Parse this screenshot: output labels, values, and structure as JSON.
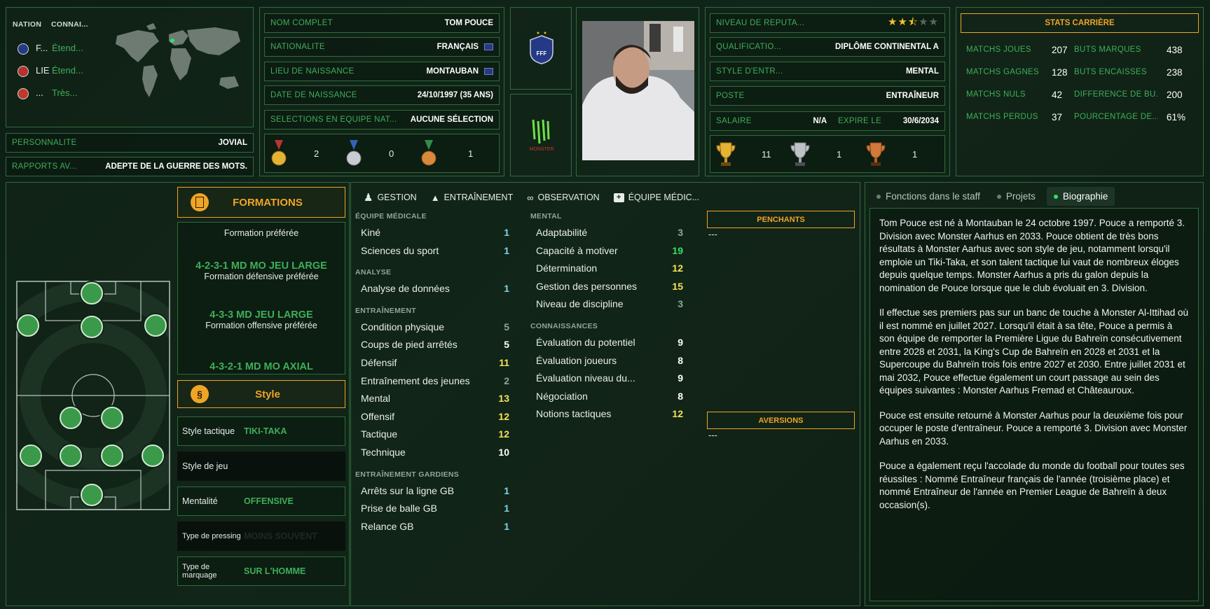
{
  "left": {
    "nation_header": "NATION",
    "connais_header": "CONNAI...",
    "nations": [
      {
        "abbr": "F...",
        "level": "Étend..."
      },
      {
        "abbr": "LIE",
        "level": "Étend..."
      },
      {
        "abbr": "...",
        "level": "Très..."
      }
    ],
    "personality_label": "PERSONNALITÉ",
    "personality_value": "JOVIAL",
    "media_label": "RAPPORTS AV...",
    "media_value": "ADEPTE DE LA GUERRE DES MOTS."
  },
  "identity": {
    "rows": [
      {
        "label": "NOM COMPLET",
        "value": "TOM POUCE"
      },
      {
        "label": "NATIONALITÉ",
        "value": "FRANÇAIS"
      },
      {
        "label": "LIEU DE NAISSANCE",
        "value": "MONTAUBAN"
      },
      {
        "label": "DATE DE NAISSANCE",
        "value": "24/10/1997 (35 ANS)"
      },
      {
        "label": "SÉLECTIONS EN ÉQUIPE NAT...",
        "value": "AUCUNE SÉLECTION"
      }
    ],
    "medals": {
      "gold": "2",
      "silver": "0",
      "bronze": "1"
    }
  },
  "club": {
    "fed_label": "FFF",
    "sponsor_label": "MONSTER"
  },
  "contract": {
    "rep_label": "NIVEAU DE RÉPUTA...",
    "rep_stars": 2.5,
    "rows": [
      {
        "label": "QUALIFICATIO...",
        "value": "DIPLÔME CONTINENTAL A"
      },
      {
        "label": "STYLE D'ENTR...",
        "value": "MENTAL"
      },
      {
        "label": "POSTE",
        "value": "ENTRAÎNEUR"
      }
    ],
    "salary_label": "SALAIRE",
    "salary_value": "N/A",
    "expires_label": "EXPIRE LE",
    "expires_value": "30/6/2034",
    "trophies": {
      "gold": "11",
      "silver": "1",
      "bronze": "1"
    }
  },
  "career": {
    "title": "STATS CARRIÈRE",
    "left": [
      {
        "label": "MATCHS JOUÉS",
        "value": "207"
      },
      {
        "label": "MATCHS GAGNÉS",
        "value": "128"
      },
      {
        "label": "MATCHS NULS",
        "value": "42"
      },
      {
        "label": "MATCHS PERDUS",
        "value": "37"
      }
    ],
    "right": [
      {
        "label": "BUTS MARQUÉS",
        "value": "438"
      },
      {
        "label": "BUTS ENCAISSÉS",
        "value": "238"
      },
      {
        "label": "DIFFÉRENCE DE BU...",
        "value": "200"
      },
      {
        "label": "POURCENTAGE DE...",
        "value": "61%"
      }
    ]
  },
  "tactics": {
    "formations_title": "FORMATIONS",
    "preferred_caption": "Formation préférée",
    "f1": "4-2-3-1 MD MO JEU LARGE",
    "f1_cap": "Formation défensive préférée",
    "f2": "4-3-3 MD JEU LARGE",
    "f2_cap": "Formation offensive préférée",
    "f3": "4-3-2-1 MD MO AXIAL",
    "style_title": "Style",
    "style_rows": [
      {
        "label": "Style tactique",
        "value": "TIKI-TAKA"
      },
      {
        "label": "Style de jeu",
        "value": ""
      },
      {
        "label": "Mentalité",
        "value": "OFFENSIVE"
      },
      {
        "label": "Type de pressing",
        "value": "MOINS SOUVENT"
      },
      {
        "label": "Type de marquage",
        "value": "SUR L'HOMME"
      }
    ]
  },
  "attrs": {
    "tabs": [
      "GESTION",
      "ENTRAÎNEMENT",
      "OBSERVATION",
      "ÉQUIPE MÉDIC..."
    ],
    "col1": [
      {
        "h": "ÉQUIPE MÉDICALE",
        "items": [
          {
            "n": "Kiné",
            "v": "1",
            "c": "b"
          },
          {
            "n": "Sciences du sport",
            "v": "1",
            "c": "b"
          }
        ]
      },
      {
        "h": "ANALYSE",
        "items": [
          {
            "n": "Analyse de données",
            "v": "1",
            "c": "b"
          }
        ]
      },
      {
        "h": "ENTRAÎNEMENT",
        "items": [
          {
            "n": "Condition physique",
            "v": "5",
            "c": "g"
          },
          {
            "n": "Coups de pied arrêtés",
            "v": "5",
            "c": "w"
          },
          {
            "n": "Défensif",
            "v": "11",
            "c": "y"
          },
          {
            "n": "Entraînement des jeunes",
            "v": "2",
            "c": "g"
          },
          {
            "n": "Mental",
            "v": "13",
            "c": "y"
          },
          {
            "n": "Offensif",
            "v": "12",
            "c": "y"
          },
          {
            "n": "Tactique",
            "v": "12",
            "c": "y"
          },
          {
            "n": "Technique",
            "v": "10",
            "c": "w"
          }
        ]
      },
      {
        "h": "ENTRAÎNEMENT GARDIENS",
        "items": [
          {
            "n": "Arrêts sur la ligne GB",
            "v": "1",
            "c": "b"
          },
          {
            "n": "Prise de balle GB",
            "v": "1",
            "c": "b"
          },
          {
            "n": "Relance GB",
            "v": "1",
            "c": "b"
          }
        ]
      }
    ],
    "col2": [
      {
        "h": "MENTAL",
        "items": [
          {
            "n": "Adaptabilité",
            "v": "3",
            "c": "g"
          },
          {
            "n": "Capacité à motiver",
            "v": "19",
            "c": "gr"
          },
          {
            "n": "Détermination",
            "v": "12",
            "c": "y"
          },
          {
            "n": "Gestion des personnes",
            "v": "15",
            "c": "y"
          },
          {
            "n": "Niveau de discipline",
            "v": "3",
            "c": "g"
          }
        ]
      },
      {
        "h": "CONNAISSANCES",
        "items": [
          {
            "n": "Évaluation du potentiel",
            "v": "9",
            "c": "w"
          },
          {
            "n": "Évaluation joueurs",
            "v": "8",
            "c": "w"
          },
          {
            "n": "Évaluation niveau du...",
            "v": "9",
            "c": "w"
          },
          {
            "n": "Négociation",
            "v": "8",
            "c": "w"
          },
          {
            "n": "Notions tactiques",
            "v": "12",
            "c": "y"
          }
        ]
      }
    ],
    "likes_title": "PENCHANTS",
    "likes_value": "---",
    "dislikes_title": "AVERSIONS",
    "dislikes_value": "---"
  },
  "bio": {
    "tabs": [
      "Fonctions dans le staff",
      "Projets",
      "Biographie"
    ],
    "p1": "Tom Pouce est né à Montauban le 24 octobre 1997. Pouce a remporté 3. Division avec Monster Aarhus en 2033. Pouce obtient de très bons résultats à Monster Aarhus avec son style de jeu, notamment lorsqu'il emploie un Tiki-Taka, et son talent tactique lui vaut de nombreux éloges depuis quelque temps. Monster Aarhus a pris du galon depuis la nomination de Pouce lorsque que le club évoluait en 3. Division.",
    "p2": "Il effectue ses premiers pas sur un banc de touche à Monster Al-Ittihad où il est nommé en juillet 2027. Lorsqu'il était à sa tête, Pouce a permis à son équipe de remporter la Première Ligue du Bahreïn consécutivement entre 2028 et 2031, la King's Cup de Bahreïn en 2028 et 2031 et la Supercoupe du Bahreïn trois fois entre 2027 et 2030. Entre juillet 2031 et mai 2032, Pouce effectue également un court passage au sein des équipes suivantes : Monster Aarhus Fremad et Châteauroux.",
    "p3": "Pouce est ensuite retourné à Monster Aarhus pour la deuxième fois pour occuper le poste d'entraîneur. Pouce a remporté 3. Division avec Monster Aarhus en 2033.",
    "p4": "Pouce a également reçu l'accolade du monde du football pour toutes ses réussites : Nommé Entraîneur français de l'année (troisième place) et nommé Entraîneur de l'année en Premier League de Bahreïn à deux occasion(s)."
  }
}
